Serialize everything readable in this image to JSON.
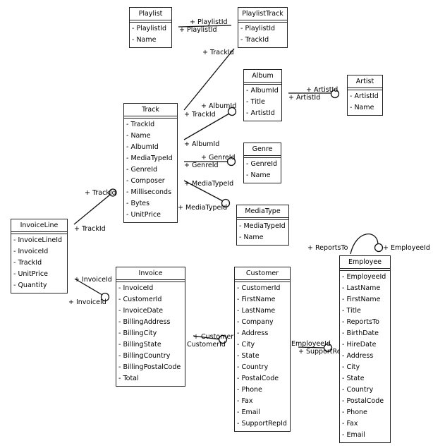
{
  "diagram": {
    "type": "entity-relationship",
    "entities": {
      "playlist": {
        "name": "Playlist",
        "fields": [
          "- PlaylistId",
          "- Name"
        ]
      },
      "playlisttrack": {
        "name": "PlaylistTrack",
        "fields": [
          "- PlaylistId",
          "- TrackId"
        ]
      },
      "album": {
        "name": "Album",
        "fields": [
          "- AlbumId",
          "- Title",
          "- ArtistId"
        ]
      },
      "artist": {
        "name": "Artist",
        "fields": [
          "- ArtistId",
          "- Name"
        ]
      },
      "track": {
        "name": "Track",
        "fields": [
          "- TrackId",
          "- Name",
          "- AlbumId",
          "- MediaTypeId",
          "- GenreId",
          "- Composer",
          "- Milliseconds",
          "- Bytes",
          "- UnitPrice"
        ]
      },
      "genre": {
        "name": "Genre",
        "fields": [
          "- GenreId",
          "- Name"
        ]
      },
      "mediatype": {
        "name": "MediaType",
        "fields": [
          "- MediaTypeId",
          "- Name"
        ]
      },
      "invoiceline": {
        "name": "InvoiceLine",
        "fields": [
          "- InvoiceLineId",
          "- InvoiceId",
          "- TrackId",
          "- UnitPrice",
          "- Quantity"
        ]
      },
      "invoice": {
        "name": "Invoice",
        "fields": [
          "- InvoiceId",
          "- CustomerId",
          "- InvoiceDate",
          "- BillingAddress",
          "- BillingCity",
          "- BillingState",
          "- BillingCountry",
          "- BillingPostalCode",
          "- Total"
        ]
      },
      "customer": {
        "name": "Customer",
        "fields": [
          "- CustomerId",
          "- FirstName",
          "- LastName",
          "- Company",
          "- Address",
          "- City",
          "- State",
          "- Country",
          "- PostalCode",
          "- Phone",
          "- Fax",
          "- Email",
          "- SupportRepId"
        ]
      },
      "employee": {
        "name": "Employee",
        "fields": [
          "- EmployeeId",
          "- LastName",
          "- FirstName",
          "- Title",
          "- ReportsTo",
          "- BirthDate",
          "- HireDate",
          "- Address",
          "- City",
          "- State",
          "- Country",
          "- PostalCode",
          "- Phone",
          "- Fax",
          "- Email"
        ]
      }
    },
    "relationships": [
      {
        "id": "playlist_playlisttrack",
        "from": "Playlist",
        "to": "PlaylistTrack",
        "from_label": "+ PlaylistId",
        "to_label": "+ PlaylistId"
      },
      {
        "id": "track_playlisttrack",
        "from": "Track",
        "to": "PlaylistTrack",
        "from_label": "+ TrackId",
        "to_label": "+ TrackId"
      },
      {
        "id": "track_album",
        "from": "Track",
        "to": "Album",
        "from_label": "+ AlbumId",
        "to_label": "+ AlbumId"
      },
      {
        "id": "album_artist",
        "from": "Album",
        "to": "Artist",
        "from_label": "+ ArtistId",
        "to_label": "+ ArtistId"
      },
      {
        "id": "track_genre",
        "from": "Track",
        "to": "Genre",
        "from_label": "+ GenreId",
        "to_label": "+ GenreId"
      },
      {
        "id": "track_mediatype",
        "from": "Track",
        "to": "MediaType",
        "from_label": "+ MediaTypeId",
        "to_label": "+ MediaTypeId"
      },
      {
        "id": "invoiceline_track",
        "from": "InvoiceLine",
        "to": "Track",
        "from_label": "+ TrackId",
        "to_label": "+ TrackId"
      },
      {
        "id": "invoiceline_invoice",
        "from": "InvoiceLine",
        "to": "Invoice",
        "from_label": "+ InvoiceId",
        "to_label": "+ InvoiceId"
      },
      {
        "id": "invoice_customer",
        "from": "Invoice",
        "to": "Customer",
        "from_label": "+ CustomerId",
        "to_label": "+ CustomerId"
      },
      {
        "id": "customer_employee",
        "from": "Customer",
        "to": "Employee",
        "from_label": "+ SupportRepId",
        "to_label": "+ EmployeeId"
      },
      {
        "id": "employee_self",
        "from": "Employee",
        "to": "Employee",
        "from_label": "+ ReportsTo",
        "to_label": "+ EmployeeId"
      }
    ]
  }
}
